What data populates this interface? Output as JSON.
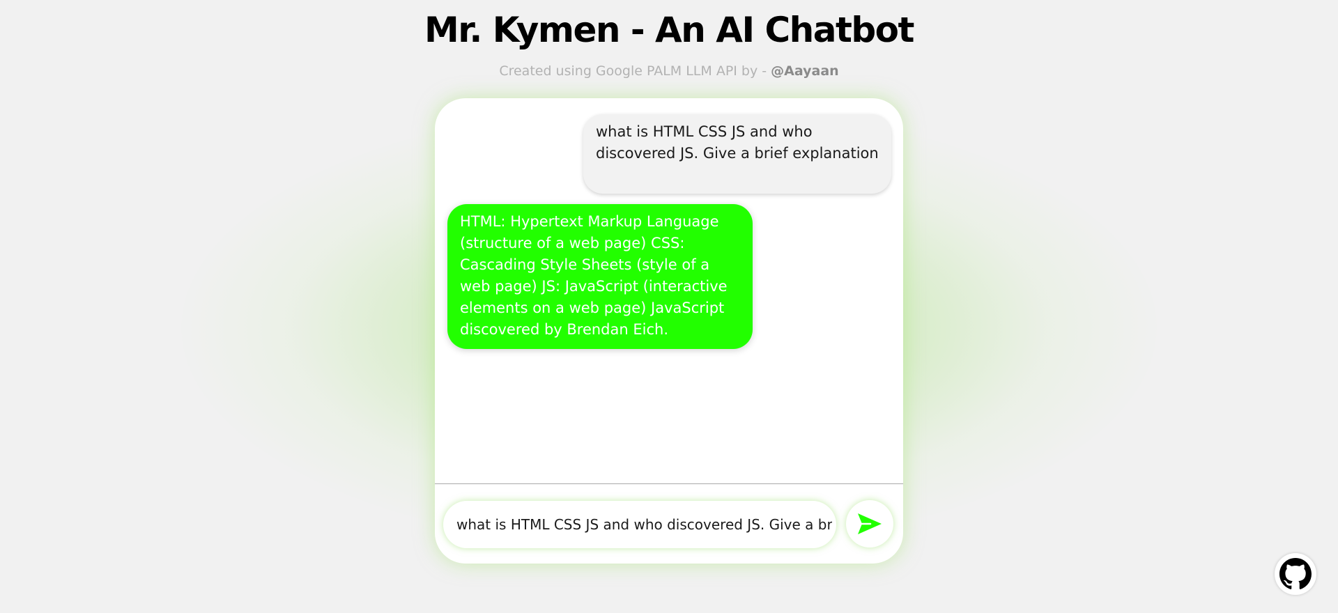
{
  "header": {
    "title": "Mr. Kymen - An AI Chatbot",
    "subtitle_prefix": "Created using Google PALM LLM API by - ",
    "subtitle_handle": "@Aayaan"
  },
  "chat": {
    "messages": [
      {
        "role": "user",
        "text": "what is HTML CSS JS and who discovered JS. Give a brief explanation"
      },
      {
        "role": "bot",
        "text": "HTML: Hypertext Markup Language (structure of a web page) CSS: Cascading Style Sheets (style of a web page) JS: JavaScript (interactive elements on a web page) JavaScript discovered by Brendan Eich."
      }
    ]
  },
  "composer": {
    "value": "what is HTML CSS JS and who discovered JS. Give a brief explanation",
    "send_icon": "send-icon"
  },
  "footer": {
    "github_icon": "github-icon"
  },
  "colors": {
    "accent": "#22ff00",
    "background": "#f1f1f1",
    "user_bubble": "#f2f2f2"
  }
}
